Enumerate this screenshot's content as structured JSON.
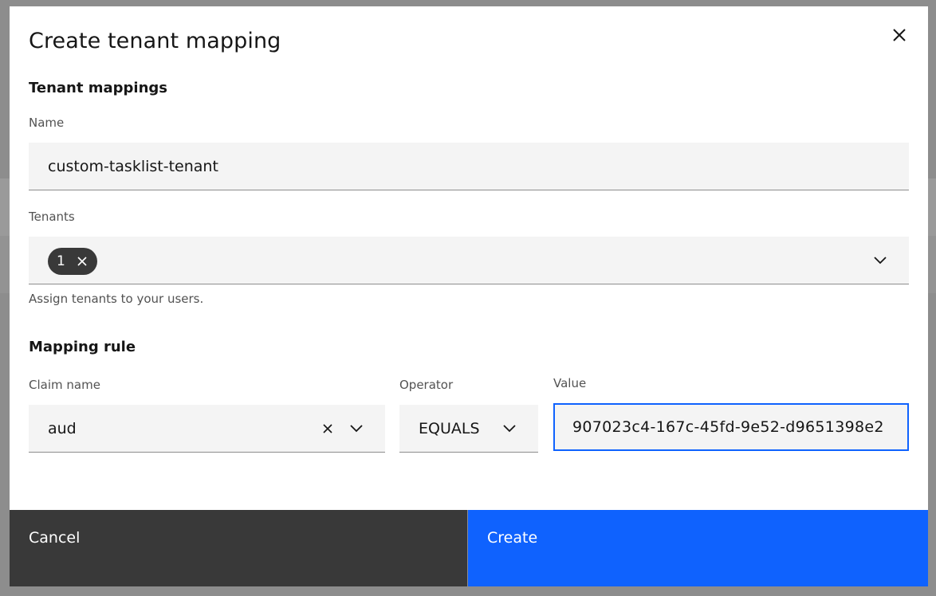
{
  "dialog": {
    "title": "Create tenant mapping",
    "close_icon": "close-icon"
  },
  "tenant_mappings": {
    "heading": "Tenant mappings",
    "name_label": "Name",
    "name_value": "custom-tasklist-tenant",
    "tenants_label": "Tenants",
    "selected_tenant_chip": "1",
    "tenants_helper": "Assign tenants to your users."
  },
  "mapping_rule": {
    "heading": "Mapping rule",
    "claim_name_label": "Claim name",
    "claim_name_value": "aud",
    "operator_label": "Operator",
    "operator_value": "EQUALS",
    "value_label": "Value",
    "value_value": "907023c4-167c-45fd-9e52-d9651398e2"
  },
  "footer": {
    "cancel_label": "Cancel",
    "create_label": "Create"
  },
  "colors": {
    "accent": "#0f62fe",
    "overlay": "#8d8d8d",
    "field_background": "#f4f4f4",
    "dark_button": "#393939"
  }
}
